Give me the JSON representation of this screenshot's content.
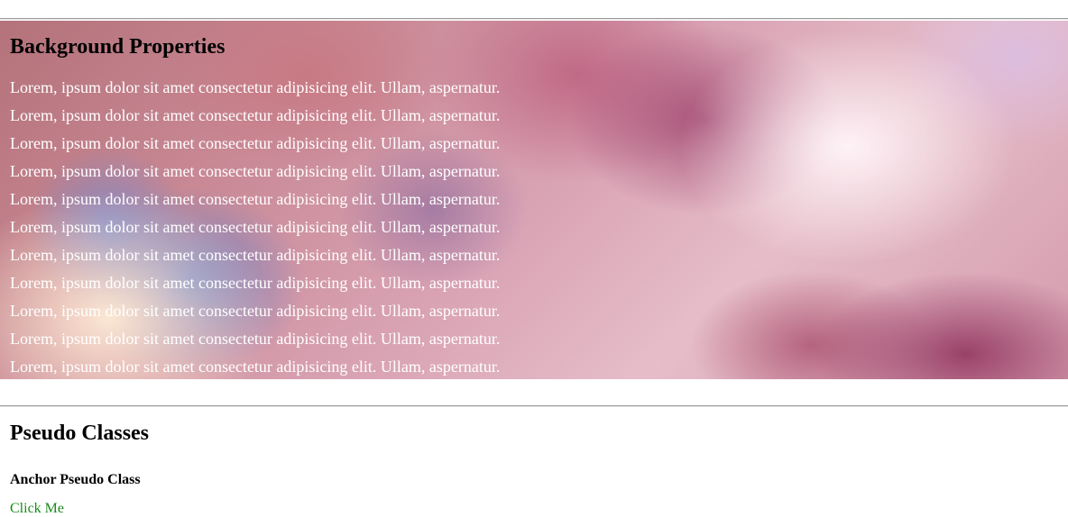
{
  "background_section": {
    "title": "Background Properties",
    "lines": [
      "Lorem, ipsum dolor sit amet consectetur adipisicing elit. Ullam, aspernatur.",
      "Lorem, ipsum dolor sit amet consectetur adipisicing elit. Ullam, aspernatur.",
      "Lorem, ipsum dolor sit amet consectetur adipisicing elit. Ullam, aspernatur.",
      "Lorem, ipsum dolor sit amet consectetur adipisicing elit. Ullam, aspernatur.",
      "Lorem, ipsum dolor sit amet consectetur adipisicing elit. Ullam, aspernatur.",
      "Lorem, ipsum dolor sit amet consectetur adipisicing elit. Ullam, aspernatur.",
      "Lorem, ipsum dolor sit amet consectetur adipisicing elit. Ullam, aspernatur.",
      "Lorem, ipsum dolor sit amet consectetur adipisicing elit. Ullam, aspernatur.",
      "Lorem, ipsum dolor sit amet consectetur adipisicing elit. Ullam, aspernatur.",
      "Lorem, ipsum dolor sit amet consectetur adipisicing elit. Ullam, aspernatur.",
      "Lorem, ipsum dolor sit amet consectetur adipisicing elit. Ullam, aspernatur."
    ],
    "text_color": "#ffffff"
  },
  "pseudo_section": {
    "title": "Pseudo Classes",
    "anchor_subtitle": "Anchor Pseudo Class",
    "link_text": "Click Me",
    "link_color": "#1a8a1a"
  }
}
